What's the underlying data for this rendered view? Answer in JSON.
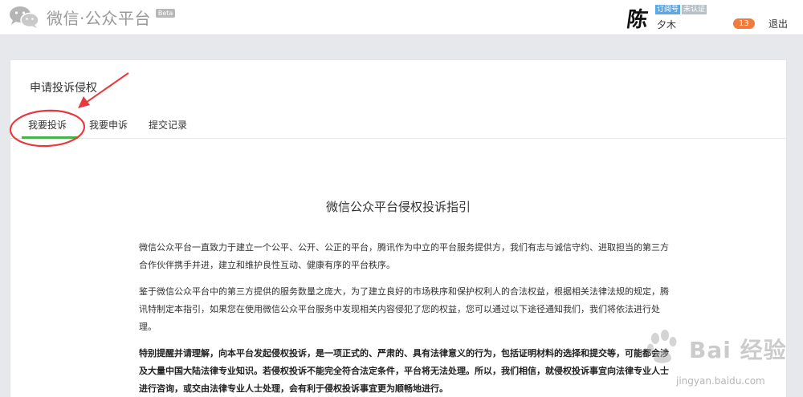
{
  "header": {
    "brand": "微信·公众平台",
    "beta": "Beta",
    "avatar_char": "陈",
    "badge_subscription": "订阅号",
    "badge_unverified": "未认证",
    "account_name": "夕木",
    "notification_count": "13",
    "logout_label": "退出"
  },
  "page": {
    "title": "申请投诉侵权",
    "tabs": [
      {
        "label": "我要投诉",
        "active": true
      },
      {
        "label": "我要申诉",
        "active": false
      },
      {
        "label": "提交记录",
        "active": false
      }
    ]
  },
  "document": {
    "title": "微信公众平台侵权投诉指引",
    "paragraphs": [
      "微信公众平台一直致力于建立一个公平、公开、公正的平台，腾讯作为中立的平台服务提供方，我们有志与诚信守约、进取担当的第三方合作伙伴携手并进，建立和维护良性互动、健康有序的平台秩序。",
      "鉴于微信公众平台中的第三方提供的服务数量之庞大，为了建立良好的市场秩序和保护权利人的合法权益，根据相关法律法规的规定，腾讯特制定本指引，如果您在使用微信公众平台服务中发现相关内容侵犯了您的权益，您可以通过以下途径通知我们，我们将依法进行处理。",
      "特别提醒并请理解，向本平台发起侵权投诉，是一项正式的、严肃的、具有法律意义的行为，包括证明材料的选择和提交等，可能都会涉及大量中国大陆法律专业知识。若侵权投诉不能完全符合法定条件，平台将无法处理。所以，我们相信，就侵权投诉事宜向法律专业人士进行咨询，或交由法律专业人士处理，会有利于侵权投诉事宜更为顺畅地进行。"
    ]
  },
  "watermark": {
    "text": "Bai 经验",
    "url": "jingyan.baidu.com"
  },
  "colors": {
    "active_tab": "#44b549",
    "annotation": "#e8383d",
    "notification": "#f17b3d",
    "badge_blue": "#5ba8e6"
  }
}
